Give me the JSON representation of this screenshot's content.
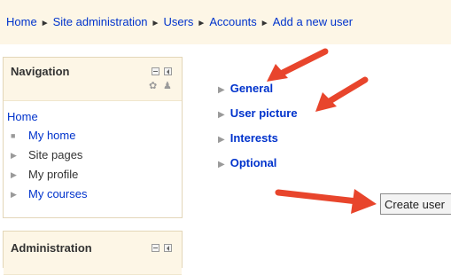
{
  "breadcrumb": {
    "items": [
      "Home",
      "Site administration",
      "Users",
      "Accounts",
      "Add a new user"
    ],
    "separator": "►"
  },
  "navigation": {
    "title": "Navigation",
    "home": "Home",
    "items": [
      "My home",
      "Site pages",
      "My profile",
      "My courses"
    ]
  },
  "administration": {
    "title": "Administration"
  },
  "form": {
    "sections": [
      "General",
      "User picture",
      "Interests",
      "Optional"
    ],
    "create_button": "Create user"
  },
  "colors": {
    "link": "#0033cc",
    "header_bg": "#fdf6e6",
    "arrow": "#e8452c"
  },
  "icons": [
    "minimize-icon",
    "dock-icon",
    "gear-icon",
    "roles-icon",
    "triangle-right-icon",
    "arrow-annotation-icon"
  ]
}
